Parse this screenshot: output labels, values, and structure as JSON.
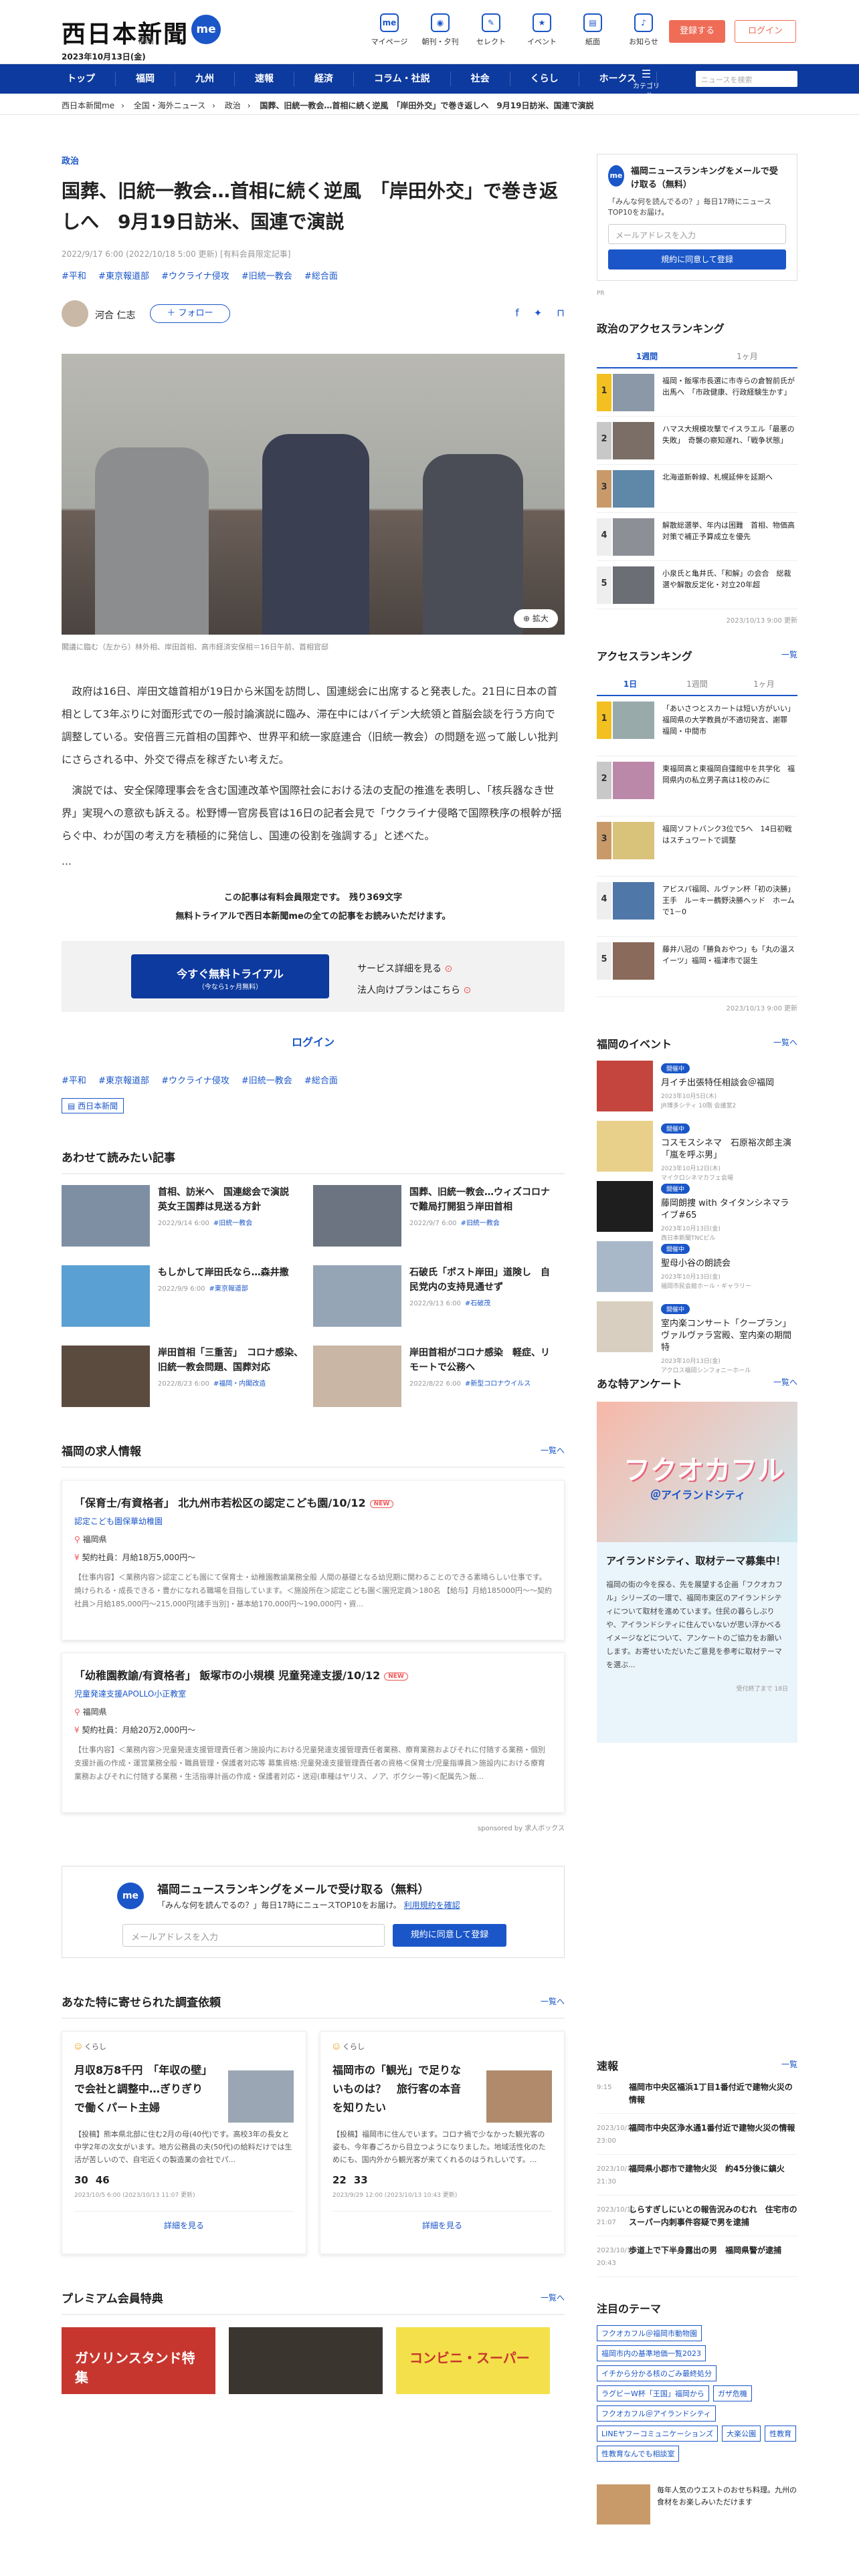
{
  "header": {
    "logo": "西日本新聞",
    "logo_badge": "me",
    "date": "2023年10月13日(金)",
    "location": "福岡",
    "nav": [
      {
        "label": "マイページ",
        "icon": "me-icon"
      },
      {
        "label": "朝刊・夕刊",
        "icon": "newspaper-icon"
      },
      {
        "label": "セレクト",
        "icon": "select-icon"
      },
      {
        "label": "イベント",
        "icon": "event-icon"
      },
      {
        "label": "紙面",
        "icon": "paper-icon"
      },
      {
        "label": "お知らせ",
        "icon": "bell-icon"
      }
    ],
    "register": "登録する",
    "login": "ログイン"
  },
  "gnav": {
    "items": [
      "トップ",
      "福岡",
      "九州",
      "速報",
      "経済",
      "コラム・社説",
      "社会",
      "くらし",
      "ホークス"
    ],
    "category": "カテゴリー他",
    "search_placeholder": "ニュースを検索"
  },
  "breadcrumb": [
    "西日本新聞me",
    "全国・海外ニュース",
    "政治",
    "国葬、旧統一教会…首相に続く逆風　「岸田外交」で巻き返しへ　9月19日訪米、国連で演説"
  ],
  "article": {
    "category": "政治",
    "title": "国葬、旧統一教会…首相に続く逆風　「岸田外交」で巻き返しへ　9月19日訪米、国連で演説",
    "meta": "2022/9/17 6:00 (2022/10/18 5:00 更新) [有料会員限定記事]",
    "tags": [
      "#平和",
      "#東京報道部",
      "#ウクライナ侵攻",
      "#旧統一教会",
      "#総合面"
    ],
    "author": "河合 仁志",
    "follow": "＋ フォロー",
    "zoom": "拡大",
    "caption": "閣議に臨む（左から）林外相、岸田首相、高市経済安保相＝16日午前、首相官邸",
    "paragraphs": [
      "政府は16日、岸田文雄首相が19日から米国を訪問し、国連総会に出席すると発表した。21日に日本の首相として3年ぶりに対面形式での一般討論演説に臨み、滞在中にはバイデン大統領と首脳会談を行う方向で調整している。安倍晋三元首相の国葬や、世界平和統一家庭連合（旧統一教会）の問題を巡って厳しい批判にさらされる中、外交で得点を稼ぎたい考えだ。",
      "演説では、安全保障理事会を含む国連改革や国際社会における法の支配の推進を表明し、「核兵器なき世界」実現への意欲も訴える。松野博一官房長官は16日の記者会見で「ウクライナ侵略で国際秩序の根幹が揺らぐ中、わが国の考え方を積極的に発信し、国連の役割を強調する」と述べた。"
    ],
    "ellipsis": "…",
    "paywall_line1": "この記事は有料会員限定です。　残り369文字",
    "paywall_line2": "無料トライアルで西日本新聞meの全ての記事をお読みいただけます。",
    "trial_btn": "今すぐ無料トライアル",
    "trial_sub": "（今なら1ヶ月無料）",
    "service_link": "サービス詳細を見る",
    "corp_link": "法人向けプランはこちら",
    "login_link": "ログイン",
    "tags_bottom": [
      "#平和",
      "#東京報道部",
      "#ウクライナ侵攻",
      "#旧統一教会",
      "#総合面"
    ],
    "section_badge": "西日本新聞"
  },
  "related": {
    "title": "あわせて読みたい記事",
    "items": [
      {
        "title": "首相、訪米へ　国連総会で演説　英女王国葬は見送る方針",
        "date": "2022/9/14 6:00",
        "tag": "#旧統一教会"
      },
      {
        "title": "国葬、旧統一教会…ウィズコロナで難局打開狙う岸田首相",
        "date": "2022/9/7 6:00",
        "tag": "#旧統一教会"
      },
      {
        "title": "もしかして岸田氏なら…森井撒",
        "date": "2022/9/9 6:00",
        "tag": "#東京報道部"
      },
      {
        "title": "石破氏「ポスト岸田」道険し　自民党内の支持見通せず",
        "date": "2022/9/13 6:00",
        "tag": "#石破茂"
      },
      {
        "title": "岸田首相「三重苦」　コロナ感染、旧統一教会問題、国葬対応",
        "date": "2022/8/23 6:00",
        "tag": "#福岡・内閣改造"
      },
      {
        "title": "岸田首相がコロナ感染　軽症、リモートで公務へ",
        "date": "2022/8/22 6:00",
        "tag": "#新型コロナウイルス"
      }
    ]
  },
  "jobs": {
    "title": "福岡の求人情報",
    "more": "一覧へ",
    "items": [
      {
        "title": "「保育士/有資格者」 北九州市若松区の認定こども園/10/12",
        "new": "NEW",
        "company": "認定こども園保華幼稚園",
        "location": "福岡県",
        "pay": "契約社員：月給18万5,000円〜",
        "desc": "【仕事内容】＜業務内容＞認定こども園にて保育士・幼稚園教諭業務全般 人間の基礎となる幼児期に関わることのできる素晴らしい仕事です。 焼けられる・成長できる・豊かになれる職場を目指しています。＜施設所在＞認定こども園＜園児定員＞180名 【給与】月給185000円〜〜契約社員＞月給185,000円〜215,000円[諸手当別]・基本給170,000円〜190,000円・資..."
      },
      {
        "title": "「幼稚園教諭/有資格者」 飯塚市の小規模 児童発達支援/10/12",
        "new": "NEW",
        "company": "児童発達支援APOLLO小正教室",
        "location": "福岡県",
        "pay": "契約社員：月給20万2,000円〜",
        "desc": "【仕事内容】＜業務内容＞児童発達支援管理責任者＞施設内における児童発達支援管理責任者業務、療育業務およびそれに付随する業務・個別支援計画の作成・運営業務全般・職員管理・保護者対応等 募集資格:児童発達支援管理責任者の資格＜保育士/児童指導員＞施設内における療育業務およびそれに付随する業務・生活指導計画の作成・保護者対応・送迎(車種はヤリス、ノア、ボクシー等)＜配属先＞飯..."
      }
    ],
    "sponsor": "sponsored by 求人ボックス"
  },
  "mail": {
    "icon": "me",
    "title": "福岡ニュースランキングをメールで受け取る（無料）",
    "sub": "「みんな何を読んでるの？」毎日17時にニュースTOP10をお届け。",
    "terms": "利用規約を確認",
    "placeholder": "メールアドレスを入力",
    "submit": "規約に同意して登録"
  },
  "survey": {
    "title": "あなた特に寄せられた調査依頼",
    "more": "一覧へ",
    "items": [
      {
        "cat": "くらし",
        "title": "月収8万8千円　「年収の壁」で会社と調整中…ぎりぎりで働くパート主婦",
        "desc": "【投稿】熊本県北部に住む2月の母(40代)です。高校3年の長女と中学2年の次女がいます。地方公務員の夫(50代)の給料だけでは生活が苦しいので、自宅近くの製造業の会社でパ...",
        "stat1": "30",
        "stat2": "46",
        "date": "2023/10/5 6:00 (2023/10/13 11:07 更新)",
        "link": "詳細を見る"
      },
      {
        "cat": "くらし",
        "title": "福岡市の「観光」で足りないものは？　旅行客の本音を知りたい",
        "desc": "【投稿】福岡市に住んでいます。コロナ禍で少なかった観光客の姿も、今年春ごろから目立つようになりました。地域活性化のためにも、国内外から観光客が来てくれるのはうれしいです。...",
        "stat1": "22",
        "stat2": "33",
        "date": "2023/9/29 12:00 (2023/10/13 10:43 更新)",
        "link": "詳細を見る"
      }
    ]
  },
  "premium": {
    "title": "プレミアム会員特典",
    "more": "一覧へ",
    "items": [
      "ガソリンスタンド特集",
      "",
      "コンビニ・スーパー"
    ]
  },
  "side": {
    "mail_title": "福岡ニュースランキングをメールで受け取る（無料）",
    "mail_sub": "「みんな何を読んでるの？」毎日17時にニュースTOP10をお届け。",
    "mail_placeholder": "メールアドレスを入力",
    "mail_btn": "規約に同意して登録",
    "pr": "PR",
    "pol_title": "政治のアクセスランキング",
    "pol_tabs": [
      "1週間",
      "1ヶ月"
    ],
    "pol_items": [
      "福岡・飯塚市長選に市寺らの倉智前氏が出馬へ　「市政健康、行政経験生かす」",
      "ハマス大規模攻撃でイスラエル「最悪の失敗」　奇襲の察知遅れ、「戦争状態」",
      "北海道新幹線、札幌延伸を延期へ",
      "解散総選挙、年内は困難　首相、物価高対策で補正予算成立を優先",
      "小泉氏と亀井氏、「和解」の会合　総裁選や解散反定化・対立20年超"
    ],
    "pol_ts": "2023/10/13 9:00 更新",
    "acc_title": "アクセスランキング",
    "acc_more": "一覧",
    "acc_tabs": [
      "1日",
      "1週間",
      "1ヶ月"
    ],
    "acc_items": [
      "「あいさつとスカートは短い方がいい」福岡県の大学教員が不適切発言、謝罪　福岡・中間市",
      "東福岡高と東福岡自彊館中を共学化　福岡県内の私立男子高は1校のみに",
      "福岡ソフトバンク3位で5へ　14日初戦はスチュワートで調整",
      "アビスパ福岡、ルヴァン杯「初の決勝」王手　ルーキー鶴野決勝ヘッド　ホームで1－0",
      "藤井八冠の「勝負おやつ」も「丸の温スイーツ」福岡・福津市で誕生"
    ],
    "acc_ts": "2023/10/13 9:00 更新",
    "event_title": "福岡のイベント",
    "event_more": "一覧へ",
    "events": [
      {
        "tag": "開催中",
        "title": "月イチ出張特任相談会＠福岡",
        "meta": "2023年10月5日(木)\nJR博多シティ 10階 会議室2"
      },
      {
        "tag": "開催中",
        "title": "コスモスシネマ　石原裕次郎主演「嵐を呼ぶ男」",
        "meta": "2023年10月12日(木)\nマイクロシネマカフェ会場"
      },
      {
        "tag": "開催中",
        "title": "藤岡朗捜 with タイタンシネマライブ#65",
        "meta": "2023年10月13日(金)\n西日本新聞TNCビル"
      },
      {
        "tag": "開催中",
        "title": "聖母小谷の朗読会",
        "meta": "2023年10月13日(金)\n福岡市民会館ホール・ギャラリー"
      },
      {
        "tag": "開催中",
        "title": "室内楽コンサート「クープラン」ヴァルヴァラ宮殿、室内楽の期間特",
        "meta": "2023年10月13日(金)\nアクロス福岡シンフォニーホール"
      }
    ],
    "ank_title_sec": "あな特アンケート",
    "ank_more": "一覧へ",
    "ank_logo": "フクオカフル",
    "ank_logo_sub": "＠アイランドシティ",
    "ank_title": "アイランドシティ、取材テーマ募集中！",
    "ank_desc": "福岡の街の今を探る、先を展望する企画「フクオカフル」シリーズの一環で、福岡市東区のアイランドシティについて取材を進めています。住民の暮らしぶりや、アイランドシティに住んでいないが思い浮かべるイメージなどについて、アンケートのご協力をお願いします。お寄せいただいたご意見を参考に取材テーマを選ぶ...",
    "ank_date": "受付終了まで 18日",
    "news_title": "速報",
    "news_more": "一覧",
    "news": [
      {
        "time": "9:15",
        "txt": "福岡市中央区福浜1丁目1番付近で建物火災の情報"
      },
      {
        "time": "2023/10/12 23:00",
        "txt": "福岡市中央区浄水通1番付近で建物火災の情報"
      },
      {
        "time": "2023/10/12 21:30",
        "txt": "福岡県小郡市で建物火災　約45分後に鎮火"
      },
      {
        "time": "2023/10/12 21:07",
        "txt": "しらすぎしにいとの報告況みのむれ　住宅市のスーパー内刺事件容疑で男を逮捕"
      },
      {
        "time": "2023/10/12 20:43",
        "txt": "歩道上で下半身露出の男　福岡県警が逮捕"
      }
    ],
    "theme_title": "注目のテーマ",
    "themes": [
      "フクオカフル＠福岡市動物園",
      "福岡市内の基準地価一覧2023",
      "イチから分かる核のごみ最終処分",
      "ラグビーW杯「王国」福岡から",
      "ガザ危機",
      "フクオカフル＠アイランドシティ",
      "LINEヤフーコミュニケーションズ",
      "大楽公園",
      "性教育",
      "性教育なんでも相談室"
    ],
    "bottom_note": "毎年人気のウエストのおせち料理。九州の食材をお楽しみいただけます"
  }
}
